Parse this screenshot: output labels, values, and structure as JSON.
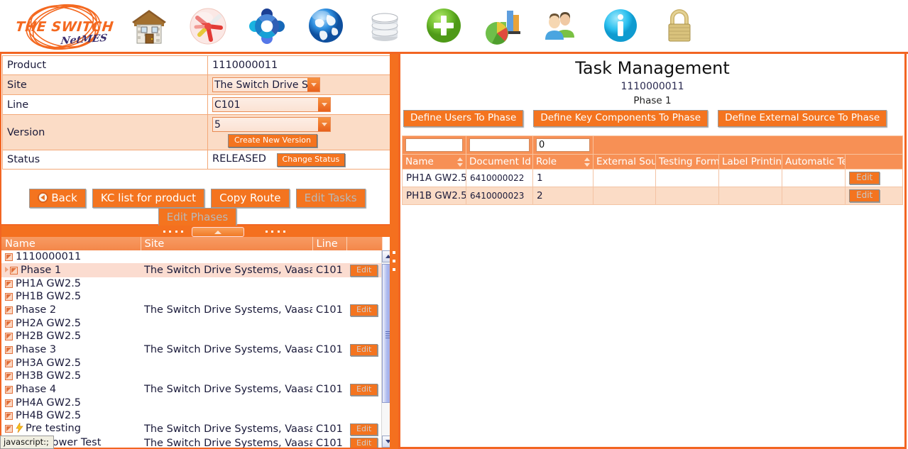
{
  "app": {
    "logo_main": "THE SWITCH",
    "logo_sub": "NetMES"
  },
  "toolbar": {
    "icons": [
      {
        "name": "home-icon",
        "label": "Home"
      },
      {
        "name": "package-icon",
        "label": "Products"
      },
      {
        "name": "process-icon",
        "label": "Process"
      },
      {
        "name": "globe-icon",
        "label": "Global"
      },
      {
        "name": "database-icon",
        "label": "Database"
      },
      {
        "name": "add-icon",
        "label": "Add"
      },
      {
        "name": "reports-chart-icon",
        "label": "Reports"
      },
      {
        "name": "users-icon",
        "label": "Users"
      },
      {
        "name": "info-icon",
        "label": "Info"
      },
      {
        "name": "lock-icon",
        "label": "Security"
      }
    ]
  },
  "left": {
    "form": {
      "product_label": "Product",
      "product_value": "1110000011",
      "site_label": "Site",
      "site_value": "The Switch Drive Syst",
      "line_label": "Line",
      "line_value": "C101",
      "version_label": "Version",
      "version_value": "5",
      "create_new_version": "Create New Version",
      "status_label": "Status",
      "status_value": "RELEASED",
      "change_status": "Change Status"
    },
    "buttons": [
      {
        "label": "Back",
        "disabled": false,
        "icon": "back-arrow-icon"
      },
      {
        "label": "KC list for product",
        "disabled": false
      },
      {
        "label": "Copy Route",
        "disabled": false
      },
      {
        "label": "Edit Tasks",
        "disabled": true
      },
      {
        "label": "Edit Phases",
        "disabled": true
      }
    ],
    "tree": {
      "headers": [
        "Name",
        "Site",
        "Line",
        ""
      ],
      "edit_label": "Edit",
      "rows": [
        {
          "indent": 0,
          "name": "1110000011",
          "site": "",
          "line": "",
          "edit": false,
          "selected": false,
          "checkbox": true,
          "expander": false,
          "bolt": false
        },
        {
          "indent": 1,
          "name": "Phase 1",
          "site": "The Switch Drive Systems, Vaasa",
          "line": "C101",
          "edit": true,
          "selected": true,
          "checkbox": true,
          "expander": true,
          "bolt": false
        },
        {
          "indent": 2,
          "name": "PH1A GW2.5",
          "site": "",
          "line": "",
          "edit": false,
          "selected": false,
          "checkbox": true,
          "expander": false,
          "bolt": false
        },
        {
          "indent": 2,
          "name": "PH1B GW2.5",
          "site": "",
          "line": "",
          "edit": false,
          "selected": false,
          "checkbox": true,
          "expander": false,
          "bolt": false
        },
        {
          "indent": 1,
          "name": "Phase 2",
          "site": "The Switch Drive Systems, Vaasa",
          "line": "C101",
          "edit": true,
          "selected": false,
          "checkbox": true,
          "expander": false,
          "bolt": false
        },
        {
          "indent": 2,
          "name": "PH2A GW2.5",
          "site": "",
          "line": "",
          "edit": false,
          "selected": false,
          "checkbox": true,
          "expander": false,
          "bolt": false
        },
        {
          "indent": 2,
          "name": "PH2B GW2.5",
          "site": "",
          "line": "",
          "edit": false,
          "selected": false,
          "checkbox": true,
          "expander": false,
          "bolt": false
        },
        {
          "indent": 1,
          "name": "Phase 3",
          "site": "The Switch Drive Systems, Vaasa",
          "line": "C101",
          "edit": true,
          "selected": false,
          "checkbox": true,
          "expander": false,
          "bolt": false
        },
        {
          "indent": 2,
          "name": "PH3A GW2.5",
          "site": "",
          "line": "",
          "edit": false,
          "selected": false,
          "checkbox": true,
          "expander": false,
          "bolt": false
        },
        {
          "indent": 2,
          "name": "PH3B GW2.5",
          "site": "",
          "line": "",
          "edit": false,
          "selected": false,
          "checkbox": true,
          "expander": false,
          "bolt": false
        },
        {
          "indent": 1,
          "name": "Phase 4",
          "site": "The Switch Drive Systems, Vaasa",
          "line": "C101",
          "edit": true,
          "selected": false,
          "checkbox": true,
          "expander": false,
          "bolt": false
        },
        {
          "indent": 2,
          "name": "PH4A GW2.5",
          "site": "",
          "line": "",
          "edit": false,
          "selected": false,
          "checkbox": true,
          "expander": false,
          "bolt": false
        },
        {
          "indent": 2,
          "name": "PH4B GW2.5",
          "site": "",
          "line": "",
          "edit": false,
          "selected": false,
          "checkbox": true,
          "expander": false,
          "bolt": false
        },
        {
          "indent": 1,
          "name": "Pre testing",
          "site": "The Switch Drive Systems, Vaasa",
          "line": "C101",
          "edit": true,
          "selected": false,
          "checkbox": true,
          "expander": false,
          "bolt": true
        },
        {
          "indent": 1,
          "name": "Full Power Test",
          "site": "The Switch Drive Systems, Vaasa",
          "line": "C101",
          "edit": true,
          "selected": false,
          "checkbox": true,
          "expander": false,
          "bolt": true
        }
      ]
    }
  },
  "right": {
    "title": "Task Management",
    "subtitle_product": "1110000011",
    "subtitle_phase": "Phase 1",
    "buttons": [
      {
        "label": "Define Users To Phase"
      },
      {
        "label": "Define Key Components To Phase"
      },
      {
        "label": "Define External Source To Phase"
      }
    ],
    "grid": {
      "filters": [
        {
          "name": "filter-name",
          "value": "",
          "placeholder": ""
        },
        {
          "name": "filter-document-id",
          "value": "",
          "placeholder": ""
        },
        {
          "name": "filter-role",
          "value": "0",
          "placeholder": ""
        }
      ],
      "headers": [
        {
          "label": "Name",
          "sortable": true
        },
        {
          "label": "Document Id",
          "sortable": false
        },
        {
          "label": "Role",
          "sortable": true
        },
        {
          "label": "External Sour",
          "sortable": false
        },
        {
          "label": "Testing Form",
          "sortable": false
        },
        {
          "label": "Label Printing",
          "sortable": false
        },
        {
          "label": "Automatic Tes",
          "sortable": false
        },
        {
          "label": "",
          "sortable": false
        }
      ],
      "edit_label": "Edit",
      "rows": [
        {
          "name": "PH1A GW2.5",
          "document_id": "6410000022",
          "role": "1",
          "external_source": "",
          "testing_form": "",
          "label_printing": "",
          "automatic_test": ""
        },
        {
          "name": "PH1B GW2.5",
          "document_id": "6410000023",
          "role": "2",
          "external_source": "",
          "testing_form": "",
          "label_printing": "",
          "automatic_test": ""
        }
      ]
    }
  },
  "statusbar": {
    "text": "javascript:;"
  },
  "colors": {
    "accent": "#f26522",
    "button": "#f4741f",
    "header": "#f79055",
    "tint": "#fbdcc6"
  }
}
